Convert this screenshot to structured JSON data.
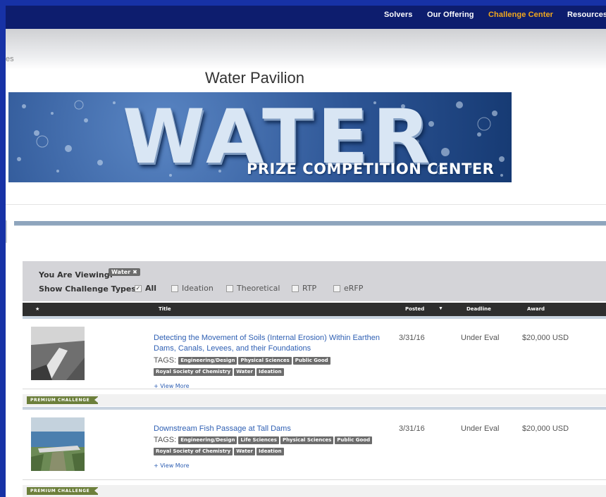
{
  "nav": {
    "items": [
      {
        "label": "Solvers",
        "active": false
      },
      {
        "label": "Our Offering",
        "active": false
      },
      {
        "label": "Challenge Center",
        "active": true
      },
      {
        "label": "Resources",
        "active": false
      }
    ]
  },
  "breadcrumb": {
    "fragment": "es"
  },
  "page": {
    "title": "Water Pavilion"
  },
  "banner": {
    "word": "WATER",
    "subtitle": "PRIZE COMPETITION CENTER"
  },
  "filter": {
    "viewing_label": "You Are Viewing:",
    "viewing_chip": "Water",
    "types_label": "Show Challenge Types:",
    "types": [
      {
        "label": "All",
        "checked": true
      },
      {
        "label": "Ideation",
        "checked": false
      },
      {
        "label": "Theoretical",
        "checked": false
      },
      {
        "label": "RTP",
        "checked": false
      },
      {
        "label": "eRFP",
        "checked": false
      }
    ]
  },
  "table": {
    "headers": {
      "star": "★",
      "title": "Title",
      "posted": "Posted",
      "deadline": "Deadline",
      "award": "Award"
    },
    "sort_caret": "▼",
    "rows": [
      {
        "title": "Detecting the Movement of Soils (Internal Erosion) Within Earthen Dams, Canals, Levees, and their Foundations",
        "tags_label": "TAGS:",
        "tags": [
          "Engineering/Design",
          "Physical Sciences",
          "Public Good",
          "Royal Society of Chemistry",
          "Water",
          "Ideation"
        ],
        "view_more": "+ View More",
        "posted": "3/31/16",
        "deadline": "Under Eval",
        "award": "$20,000 USD",
        "badge": "PREMIUM CHALLENGE"
      },
      {
        "title": "Downstream Fish Passage at Tall Dams",
        "tags_label": "TAGS:",
        "tags": [
          "Engineering/Design",
          "Life Sciences",
          "Physical Sciences",
          "Public Good",
          "Royal Society of Chemistry",
          "Water",
          "Ideation"
        ],
        "view_more": "+ View More",
        "posted": "3/31/16",
        "deadline": "Under Eval",
        "award": "$20,000 USD",
        "badge": "PREMIUM CHALLENGE"
      }
    ]
  },
  "colors": {
    "nav_bg": "#0d1d6e",
    "nav_active": "#f2a81d",
    "link": "#2e5fb3",
    "tag_bg": "#6c6c6c",
    "premium": "#6c7f3b",
    "outer_border": "#1732a6"
  }
}
